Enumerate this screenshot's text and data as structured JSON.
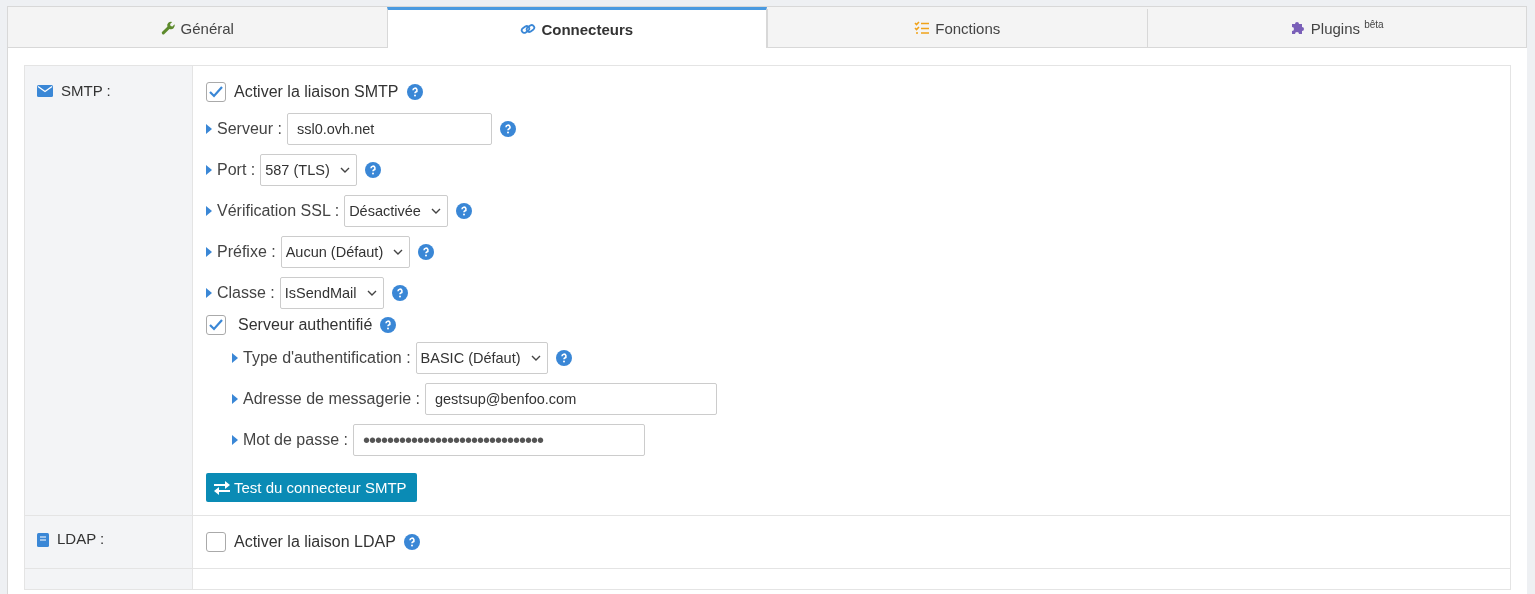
{
  "tabs": [
    {
      "label": "Général",
      "selected": false
    },
    {
      "label": "Connecteurs",
      "selected": true
    },
    {
      "label": "Fonctions",
      "selected": false
    },
    {
      "label": "Plugins $^{bêta}$",
      "selected": false
    }
  ],
  "smtp": {
    "label": "SMTP :",
    "enable": {
      "label": "Activer la liaison SMTP",
      "checked": true
    },
    "fields": [
      {
        "label": "Serveur :",
        "kind": "input",
        "value": "ssl0.ovh.net"
      },
      {
        "label": "Port :",
        "kind": "select",
        "value": "587 (TLS)"
      },
      {
        "label": "Vérification SSL :",
        "kind": "select",
        "value": "Désactivée"
      },
      {
        "label": "Préfixe :",
        "kind": "select",
        "value": "Aucun (Défaut)"
      },
      {
        "label": "Classe :",
        "kind": "select",
        "value": "IsSendMail"
      }
    ],
    "auth": {
      "label": "Serveur authentifié",
      "checked": true,
      "fields": [
        {
          "label": "Type d'authentification :",
          "kind": "select",
          "value": "BASIC (Défaut)"
        },
        {
          "label": "Adresse de messagerie :",
          "kind": "input",
          "value": "gestsup@benfoo.com"
        },
        {
          "label": "Mot de passe :",
          "kind": "password",
          "value": "••••••••••••••••••••••••••••••"
        }
      ]
    },
    "test_button": "Test du connecteur SMTP"
  },
  "ldap": {
    "label": "LDAP :",
    "enable": {
      "label": "Activer la liaison LDAP",
      "checked": false
    }
  }
}
